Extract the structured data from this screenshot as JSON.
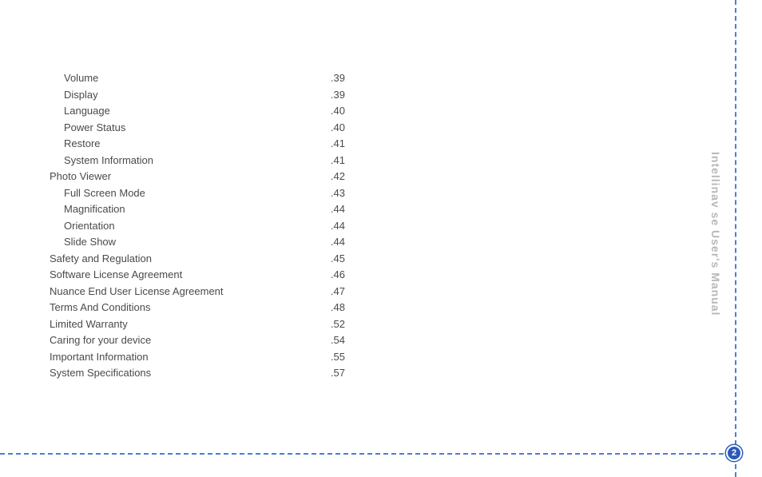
{
  "sideTitle": "Intellinav se User's Manual",
  "pageNumber": "2",
  "toc": [
    {
      "label": "Volume",
      "page": "39",
      "indent": true
    },
    {
      "label": "Display",
      "page": "39",
      "indent": true
    },
    {
      "label": "Language",
      "page": "40",
      "indent": true
    },
    {
      "label": "Power Status",
      "page": "40",
      "indent": true
    },
    {
      "label": "Restore",
      "page": "41",
      "indent": true
    },
    {
      "label": "System Information",
      "page": "41",
      "indent": true
    },
    {
      "label": "Photo Viewer",
      "page": "42",
      "indent": false
    },
    {
      "label": "Full Screen Mode",
      "page": "43",
      "indent": true
    },
    {
      "label": "Magnification",
      "page": "44",
      "indent": true
    },
    {
      "label": "Orientation",
      "page": "44",
      "indent": true
    },
    {
      "label": "Slide Show",
      "page": "44",
      "indent": true
    },
    {
      "label": "Safety and Regulation",
      "page": "45",
      "indent": false
    },
    {
      "label": "Software License Agreement",
      "page": "46",
      "indent": false
    },
    {
      "label": "Nuance End User License Agreement",
      "page": "47",
      "indent": false
    },
    {
      "label": "Terms And Conditions",
      "page": "48",
      "indent": false
    },
    {
      "label": "Limited Warranty",
      "page": "52",
      "indent": false
    },
    {
      "label": "Caring for your device",
      "page": "54",
      "indent": false
    },
    {
      "label": "Important Information",
      "page": "55",
      "indent": false
    },
    {
      "label": "System Specifications",
      "page": "57",
      "indent": false
    }
  ]
}
